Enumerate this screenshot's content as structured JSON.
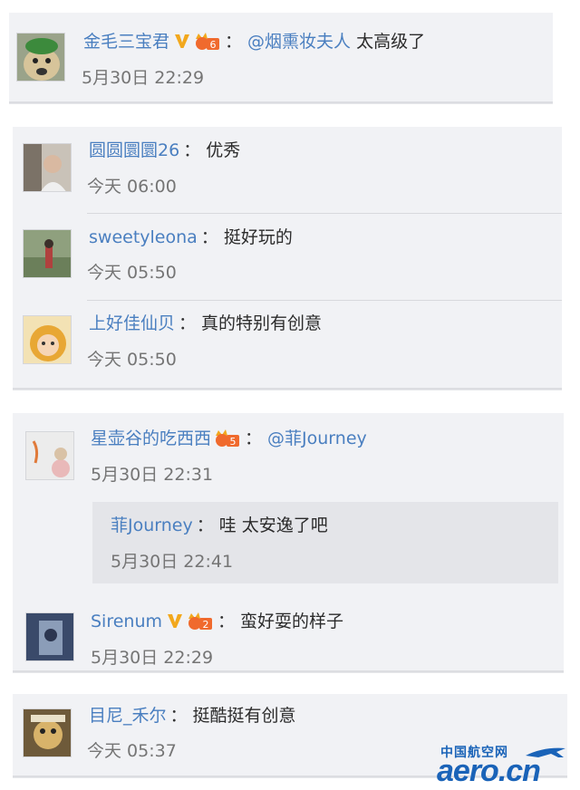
{
  "comments_group_1": [
    {
      "user": "金毛三宝君",
      "verified": true,
      "level": "6",
      "mention": "@烟熏妆夫人",
      "text": "太高级了",
      "time": "5月30日 22:29"
    }
  ],
  "comments_group_2": [
    {
      "user": "圆圆圜圜26",
      "text": "优秀",
      "time": "今天 06:00"
    },
    {
      "user": "sweetyleona",
      "text": "挺好玩的",
      "time": "今天 05:50"
    },
    {
      "user": "上好佳仙贝",
      "text": "真的特别有创意",
      "time": "今天 05:50"
    }
  ],
  "comments_group_3": {
    "main": {
      "user": "星壶谷的吃西西",
      "level": "5",
      "mention": "@菲Journey",
      "text": "",
      "time": "5月30日 22:31"
    },
    "reply": {
      "user": "菲Journey",
      "text": "哇 太安逸了吧",
      "time": "5月30日 22:41"
    },
    "second": {
      "user": "Sirenum",
      "verified": true,
      "level": "2",
      "text": "蛮好耍的样子",
      "time": "5月30日 22:29"
    }
  },
  "comments_group_4": [
    {
      "user": "目尼_禾尔",
      "text": "挺酷挺有创意",
      "time": "今天 05:37"
    }
  ],
  "colon": "：",
  "watermark": {
    "cn": "中国航空网",
    "en": "aero.cn"
  },
  "colors": {
    "link": "#4a7fc0",
    "text": "#2b2b2b",
    "time": "#757575",
    "card_bg": "#f1f2f5",
    "verified": "#f2a81d",
    "level": "#f06a2d",
    "brand": "#1a63b8"
  }
}
